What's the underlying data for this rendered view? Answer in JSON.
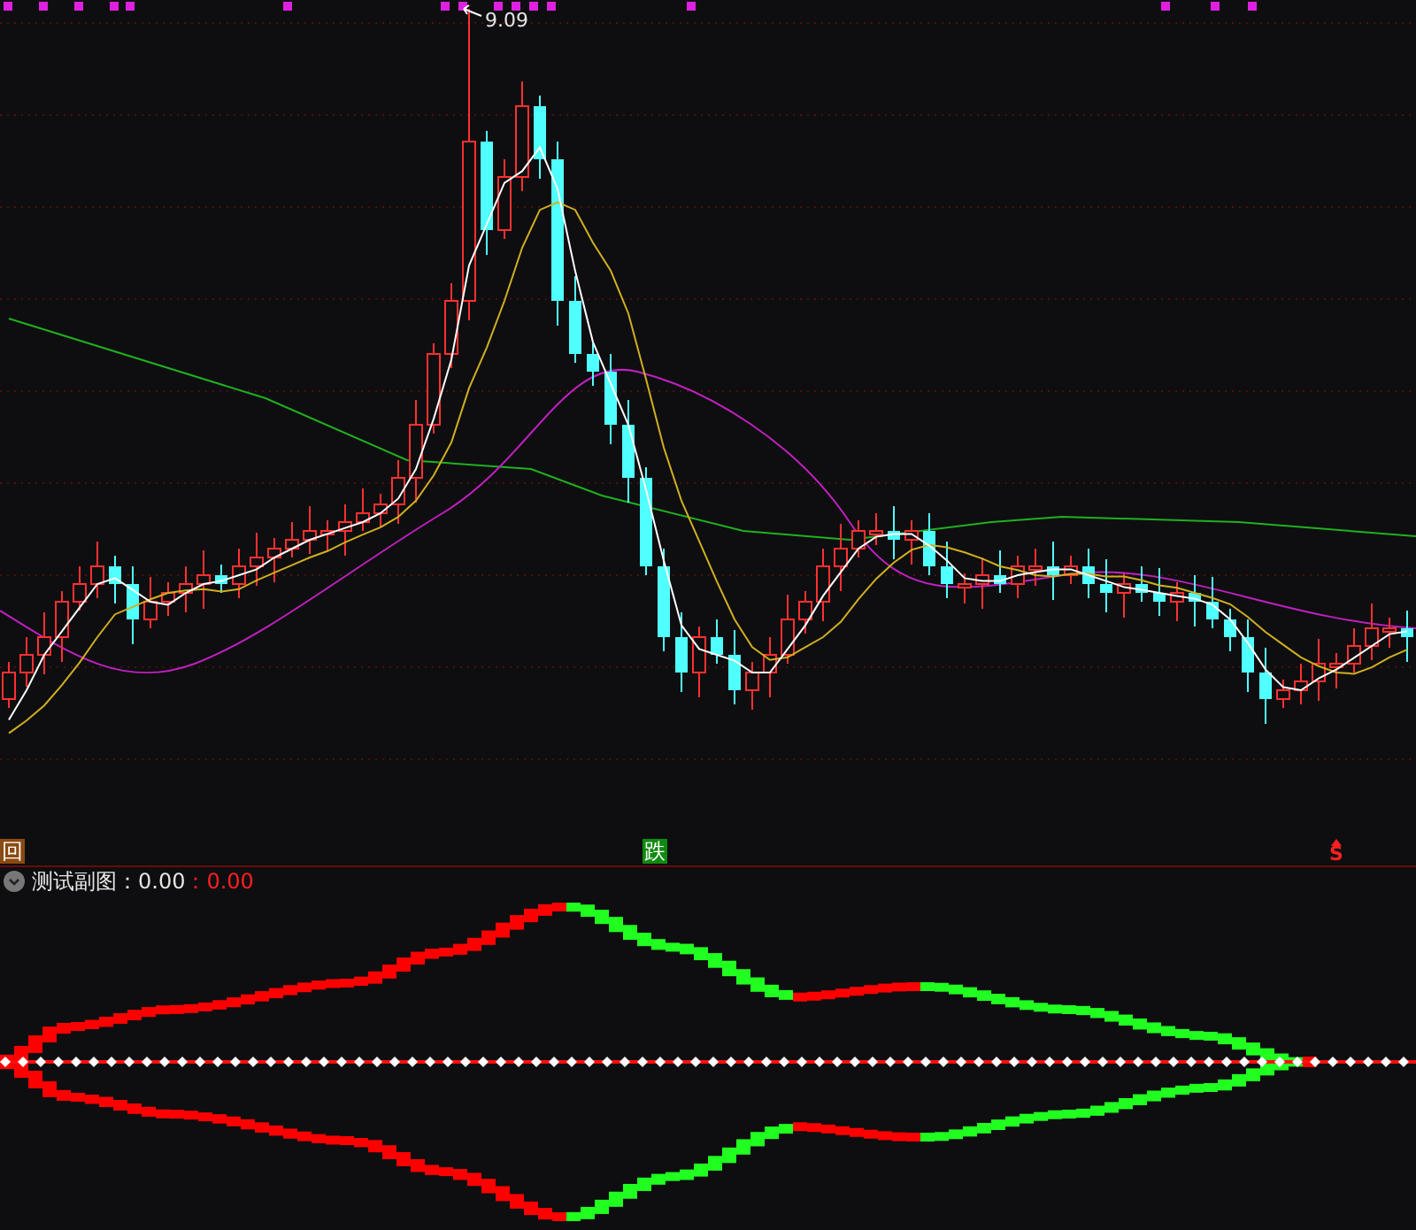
{
  "main_chart": {
    "high_label": "9.09",
    "signals": [
      {
        "kind": "box",
        "text": "回"
      },
      {
        "kind": "fall",
        "text": "跌"
      },
      {
        "kind": "sell",
        "text": "S"
      }
    ]
  },
  "sub_chart": {
    "title": "测试副图",
    "readings": [
      {
        "text": "：0.00",
        "color": "#e6e6e6"
      },
      {
        "text": "：0.00",
        "color": "#ff2020"
      }
    ]
  }
}
